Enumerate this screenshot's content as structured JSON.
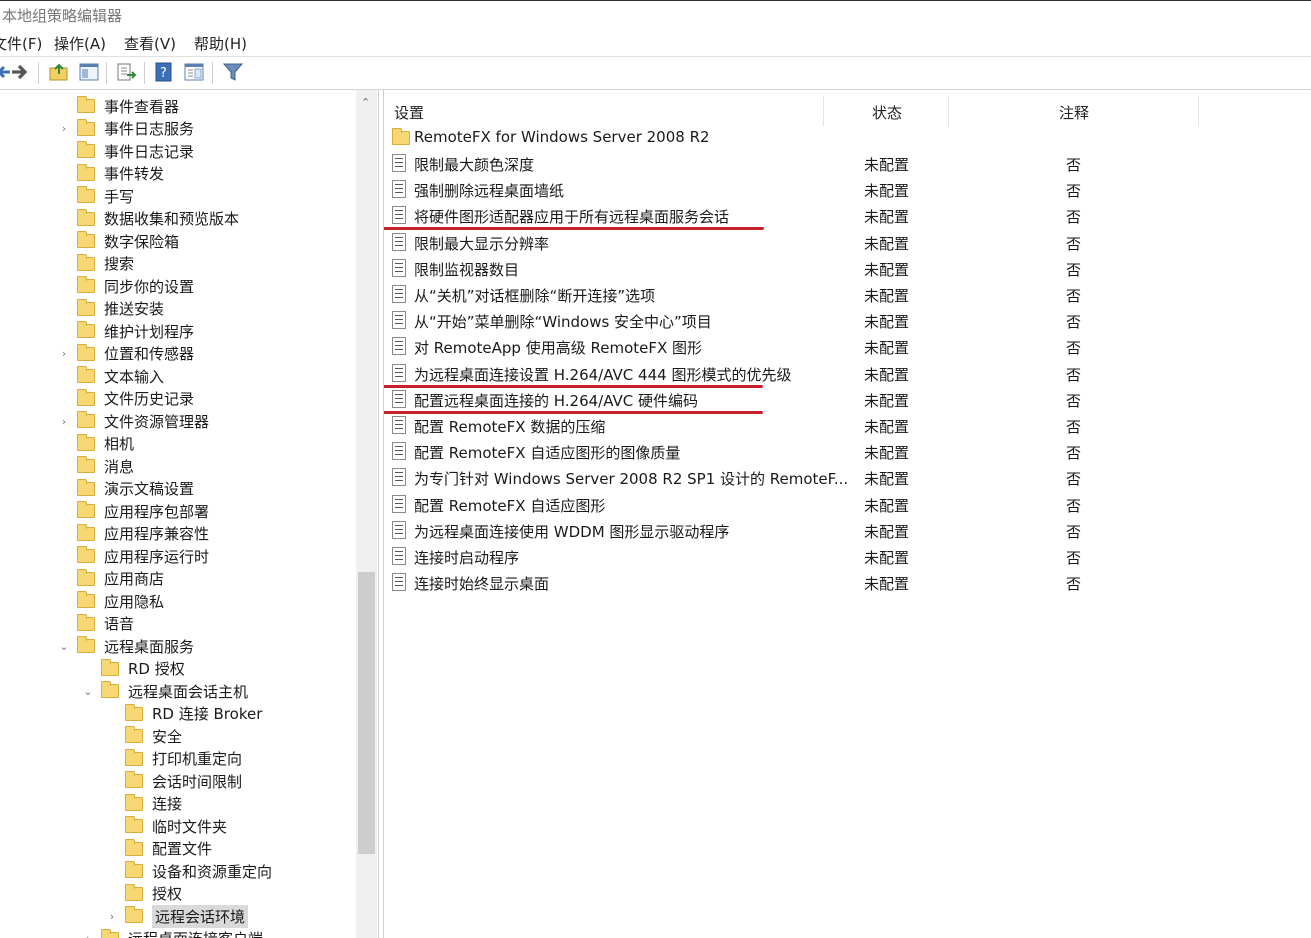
{
  "window": {
    "title": "本地组策略编辑器"
  },
  "menu": [
    "文件(F)",
    "操作(A)",
    "查看(V)",
    "帮助(H)"
  ],
  "toolbar": [
    "back-icon",
    "forward-icon",
    "up-folder-icon",
    "show-hide-tree-icon",
    "export-list-icon",
    "help-icon",
    "properties-icon",
    "filter-icon"
  ],
  "tree": [
    {
      "label": "事件查看器",
      "level": 0,
      "exp": ""
    },
    {
      "label": "事件日志服务",
      "level": 0,
      "exp": "›"
    },
    {
      "label": "事件日志记录",
      "level": 0,
      "exp": ""
    },
    {
      "label": "事件转发",
      "level": 0,
      "exp": ""
    },
    {
      "label": "手写",
      "level": 0,
      "exp": ""
    },
    {
      "label": "数据收集和预览版本",
      "level": 0,
      "exp": ""
    },
    {
      "label": "数字保险箱",
      "level": 0,
      "exp": ""
    },
    {
      "label": "搜索",
      "level": 0,
      "exp": ""
    },
    {
      "label": "同步你的设置",
      "level": 0,
      "exp": ""
    },
    {
      "label": "推送安装",
      "level": 0,
      "exp": ""
    },
    {
      "label": "维护计划程序",
      "level": 0,
      "exp": ""
    },
    {
      "label": "位置和传感器",
      "level": 0,
      "exp": "›"
    },
    {
      "label": "文本输入",
      "level": 0,
      "exp": ""
    },
    {
      "label": "文件历史记录",
      "level": 0,
      "exp": ""
    },
    {
      "label": "文件资源管理器",
      "level": 0,
      "exp": "›"
    },
    {
      "label": "相机",
      "level": 0,
      "exp": ""
    },
    {
      "label": "消息",
      "level": 0,
      "exp": ""
    },
    {
      "label": "演示文稿设置",
      "level": 0,
      "exp": ""
    },
    {
      "label": "应用程序包部署",
      "level": 0,
      "exp": ""
    },
    {
      "label": "应用程序兼容性",
      "level": 0,
      "exp": ""
    },
    {
      "label": "应用程序运行时",
      "level": 0,
      "exp": ""
    },
    {
      "label": "应用商店",
      "level": 0,
      "exp": ""
    },
    {
      "label": "应用隐私",
      "level": 0,
      "exp": ""
    },
    {
      "label": "语音",
      "level": 0,
      "exp": ""
    },
    {
      "label": "远程桌面服务",
      "level": 0,
      "exp": "⌄"
    },
    {
      "label": "RD 授权",
      "level": 1,
      "exp": ""
    },
    {
      "label": "远程桌面会话主机",
      "level": 1,
      "exp": "⌄"
    },
    {
      "label": "RD 连接 Broker",
      "level": 2,
      "exp": ""
    },
    {
      "label": "安全",
      "level": 2,
      "exp": ""
    },
    {
      "label": "打印机重定向",
      "level": 2,
      "exp": ""
    },
    {
      "label": "会话时间限制",
      "level": 2,
      "exp": ""
    },
    {
      "label": "连接",
      "level": 2,
      "exp": ""
    },
    {
      "label": "临时文件夹",
      "level": 2,
      "exp": ""
    },
    {
      "label": "配置文件",
      "level": 2,
      "exp": ""
    },
    {
      "label": "设备和资源重定向",
      "level": 2,
      "exp": ""
    },
    {
      "label": "授权",
      "level": 2,
      "exp": ""
    },
    {
      "label": "远程会话环境",
      "level": 2,
      "exp": "›",
      "selected": true
    },
    {
      "label": "远程桌面连接客户端",
      "level": 1,
      "exp": "›"
    }
  ],
  "columns": {
    "setting": "设置",
    "state": "状态",
    "note": "注释"
  },
  "folder_row": "RemoteFX for Windows Server 2008 R2",
  "rows": [
    {
      "name": "限制最大颜色深度",
      "state": "未配置",
      "note": "否"
    },
    {
      "name": "强制删除远程桌面墙纸",
      "state": "未配置",
      "note": "否"
    },
    {
      "name": "将硬件图形适配器应用于所有远程桌面服务会话",
      "state": "未配置",
      "note": "否",
      "highlight": true
    },
    {
      "name": "限制最大显示分辨率",
      "state": "未配置",
      "note": "否"
    },
    {
      "name": "限制监视器数目",
      "state": "未配置",
      "note": "否"
    },
    {
      "name": "从“关机”对话框删除“断开连接”选项",
      "state": "未配置",
      "note": "否"
    },
    {
      "name": "从“开始”菜单删除“Windows 安全中心”项目",
      "state": "未配置",
      "note": "否"
    },
    {
      "name": "对 RemoteApp 使用高级 RemoteFX 图形",
      "state": "未配置",
      "note": "否"
    },
    {
      "name": "为远程桌面连接设置 H.264/AVC 444 图形模式的优先级",
      "state": "未配置",
      "note": "否",
      "highlight": true
    },
    {
      "name": "配置远程桌面连接的 H.264/AVC 硬件编码",
      "state": "未配置",
      "note": "否",
      "highlight": true
    },
    {
      "name": "配置 RemoteFX 数据的压缩",
      "state": "未配置",
      "note": "否"
    },
    {
      "name": "配置 RemoteFX 自适应图形的图像质量",
      "state": "未配置",
      "note": "否"
    },
    {
      "name": "为专门针对 Windows Server 2008 R2 SP1 设计的 RemoteF...",
      "state": "未配置",
      "note": "否"
    },
    {
      "name": "配置 RemoteFX 自适应图形",
      "state": "未配置",
      "note": "否"
    },
    {
      "name": "为远程桌面连接使用 WDDM 图形显示驱动程序",
      "state": "未配置",
      "note": "否"
    },
    {
      "name": "连接时启动程序",
      "state": "未配置",
      "note": "否"
    },
    {
      "name": "连接时始终显示桌面",
      "state": "未配置",
      "note": "否"
    }
  ],
  "colors": {
    "highlight_line": "#c8202a",
    "folder": "#f7d774",
    "selection": "#d9d9d9"
  }
}
